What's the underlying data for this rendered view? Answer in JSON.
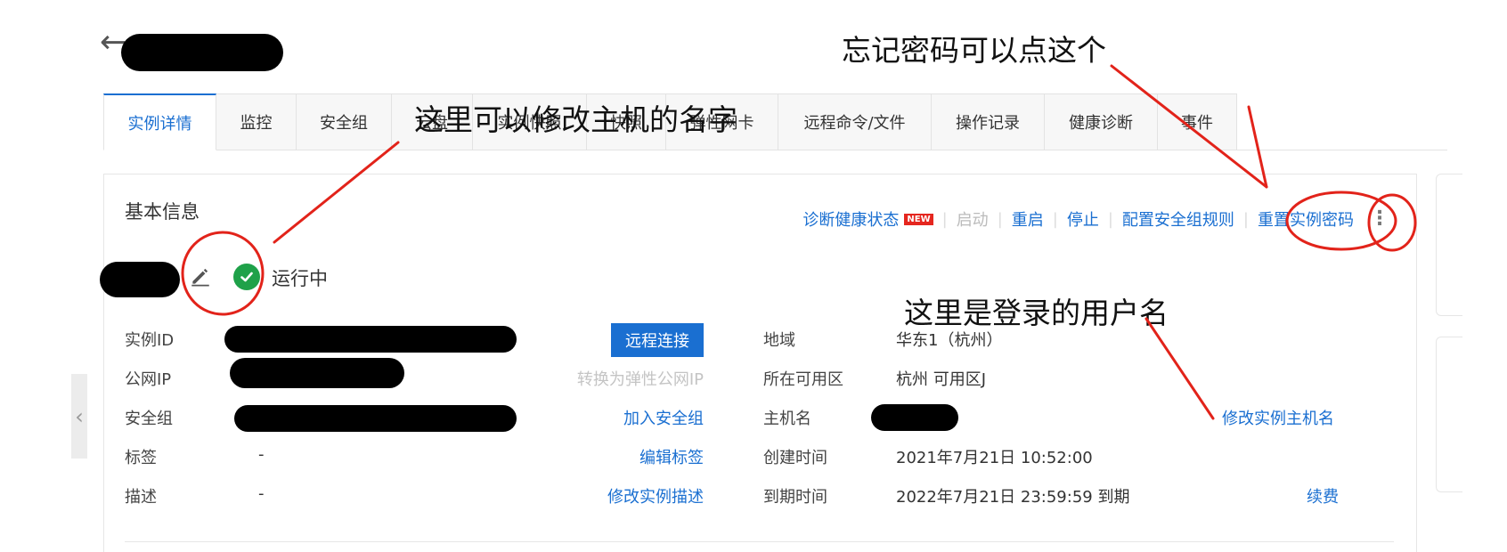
{
  "header": {
    "back_icon": "arrow-left-icon"
  },
  "tabs": [
    {
      "label": "实例详情"
    },
    {
      "label": "监控"
    },
    {
      "label": "安全组"
    },
    {
      "label": "云盘"
    },
    {
      "label": "实例快照"
    },
    {
      "label": "快照"
    },
    {
      "label": "弹性网卡"
    },
    {
      "label": "远程命令/文件"
    },
    {
      "label": "操作记录"
    },
    {
      "label": "健康诊断"
    },
    {
      "label": "事件"
    }
  ],
  "section": {
    "title": "基本信息"
  },
  "actions": {
    "diagnose": "诊断健康状态",
    "new_badge": "NEW",
    "start": "启动",
    "restart": "重启",
    "stop": "停止",
    "sg_rules": "配置安全组规则",
    "reset_password": "重置实例密码",
    "more": "⋮"
  },
  "instance": {
    "status": "运行中",
    "status_color": "#1fa149"
  },
  "fields": {
    "instance_id_label": "实例ID",
    "remote_connect": "远程连接",
    "public_ip_label": "公网IP",
    "eip_convert": "转换为弹性公网IP",
    "sg_label": "安全组",
    "join_sg": "加入安全组",
    "tags_label": "标签",
    "tags_value": "-",
    "edit_tags": "编辑标签",
    "desc_label": "描述",
    "desc_value": "-",
    "edit_desc": "修改实例描述",
    "region_label": "地域",
    "region_value": "华东1（杭州）",
    "zone_label": "所在可用区",
    "zone_value": "杭州 可用区J",
    "hostname_label": "主机名",
    "edit_hostname": "修改实例主机名",
    "created_label": "创建时间",
    "created_value": "2021年7月21日 10:52:00",
    "expire_label": "到期时间",
    "expire_value": "2022年7月21日 23:59:59 到期",
    "renew": "续费"
  },
  "annotations": {
    "forgot_password": "忘记密码可以点这个",
    "rename_host": "这里可以修改主机的名字",
    "login_user": "这里是登录的用户名",
    "color": "#e2231a"
  },
  "colors": {
    "link": "#1a6fd1",
    "primary": "#1a6fd1",
    "badge": "#e5261f"
  }
}
